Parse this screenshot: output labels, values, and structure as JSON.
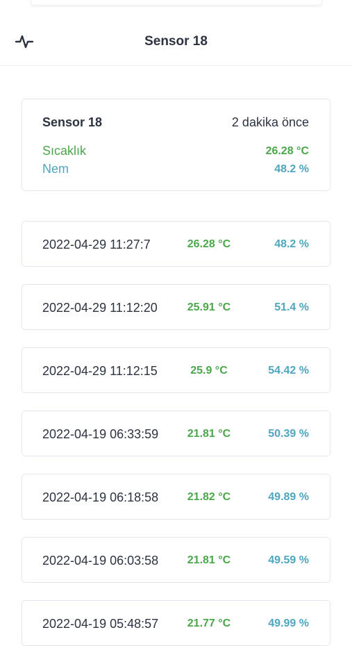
{
  "header": {
    "title": "Sensor 18",
    "icon": "activity-pulse-icon"
  },
  "summary": {
    "name": "Sensor 18",
    "ago": "2 dakika önce",
    "temp_label": "Sıcaklık",
    "temp_value": "26.28 °C",
    "hum_label": "Nem",
    "hum_value": "48.2 %"
  },
  "readings": [
    {
      "time": "2022-04-29 11:27:7",
      "temp": "26.28 °C",
      "hum": "48.2 %"
    },
    {
      "time": "2022-04-29 11:12:20",
      "temp": "25.91 °C",
      "hum": "51.4 %"
    },
    {
      "time": "2022-04-29 11:12:15",
      "temp": "25.9 °C",
      "hum": "54.42 %"
    },
    {
      "time": "2022-04-19 06:33:59",
      "temp": "21.81 °C",
      "hum": "50.39 %"
    },
    {
      "time": "2022-04-19 06:18:58",
      "temp": "21.82 °C",
      "hum": "49.89 %"
    },
    {
      "time": "2022-04-19 06:03:58",
      "temp": "21.81 °C",
      "hum": "49.59 %"
    },
    {
      "time": "2022-04-19 05:48:57",
      "temp": "21.77 °C",
      "hum": "49.99 %"
    }
  ],
  "colors": {
    "temperature": "#4aa74a",
    "humidity": "#4ea6bd",
    "text": "#2c3340"
  }
}
